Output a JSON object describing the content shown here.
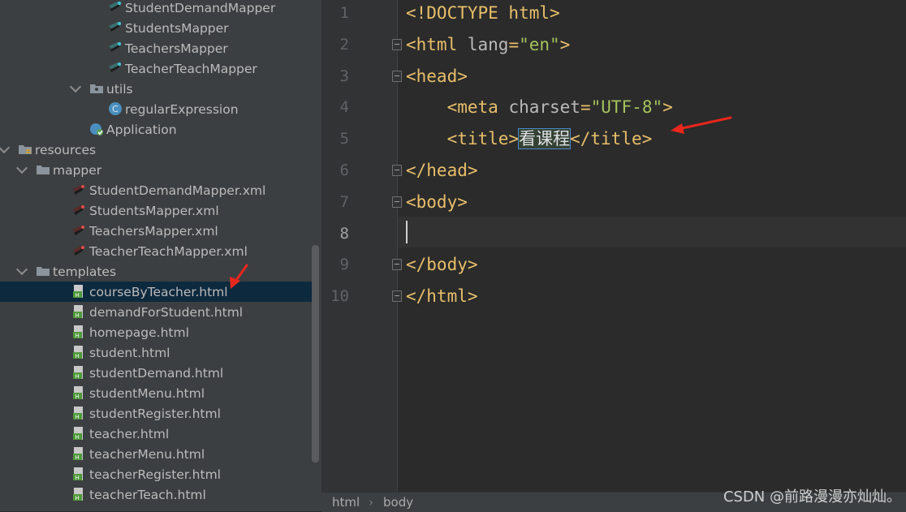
{
  "project_tree": [
    {
      "label": "StudentDemandMapper",
      "icon": "mapper-interface-icon",
      "level": 6,
      "expander": "none"
    },
    {
      "label": "StudentsMapper",
      "icon": "mapper-interface-icon",
      "level": 6,
      "expander": "none"
    },
    {
      "label": "TeachersMapper",
      "icon": "mapper-interface-icon",
      "level": 6,
      "expander": "none"
    },
    {
      "label": "TeacherTeachMapper",
      "icon": "mapper-interface-icon",
      "level": 6,
      "expander": "none"
    },
    {
      "label": "utils",
      "icon": "package-folder-icon",
      "level": 5,
      "expander": "open"
    },
    {
      "label": "regularExpression",
      "icon": "java-class-icon",
      "level": 6,
      "expander": "none"
    },
    {
      "label": "Application",
      "icon": "spring-boot-app-icon",
      "level": 5,
      "expander": "none"
    },
    {
      "label": "resources",
      "icon": "resources-folder-icon",
      "level": 1,
      "expander": "open"
    },
    {
      "label": "mapper",
      "icon": "folder-icon",
      "level": 2,
      "expander": "open"
    },
    {
      "label": "StudentDemandMapper.xml",
      "icon": "mybatis-xml-icon",
      "level": 4,
      "expander": "none"
    },
    {
      "label": "StudentsMapper.xml",
      "icon": "mybatis-xml-icon",
      "level": 4,
      "expander": "none"
    },
    {
      "label": "TeachersMapper.xml",
      "icon": "mybatis-xml-icon",
      "level": 4,
      "expander": "none"
    },
    {
      "label": "TeacherTeachMapper.xml",
      "icon": "mybatis-xml-icon",
      "level": 4,
      "expander": "none"
    },
    {
      "label": "templates",
      "icon": "folder-icon",
      "level": 2,
      "expander": "open"
    },
    {
      "label": "courseByTeacher.html",
      "icon": "html-file-icon",
      "level": 4,
      "expander": "none",
      "selected": true
    },
    {
      "label": "demandForStudent.html",
      "icon": "html-file-icon",
      "level": 4,
      "expander": "none"
    },
    {
      "label": "homepage.html",
      "icon": "html-file-icon",
      "level": 4,
      "expander": "none"
    },
    {
      "label": "student.html",
      "icon": "html-file-icon",
      "level": 4,
      "expander": "none"
    },
    {
      "label": "studentDemand.html",
      "icon": "html-file-icon",
      "level": 4,
      "expander": "none"
    },
    {
      "label": "studentMenu.html",
      "icon": "html-file-icon",
      "level": 4,
      "expander": "none"
    },
    {
      "label": "studentRegister.html",
      "icon": "html-file-icon",
      "level": 4,
      "expander": "none"
    },
    {
      "label": "teacher.html",
      "icon": "html-file-icon",
      "level": 4,
      "expander": "none"
    },
    {
      "label": "teacherMenu.html",
      "icon": "html-file-icon",
      "level": 4,
      "expander": "none"
    },
    {
      "label": "teacherRegister.html",
      "icon": "html-file-icon",
      "level": 4,
      "expander": "none"
    },
    {
      "label": "teacherTeach.html",
      "icon": "html-file-icon",
      "level": 4,
      "expander": "none"
    }
  ],
  "editor": {
    "current_line": 8,
    "lines": [
      {
        "n": "1",
        "parts": [
          {
            "t": "<!DOCTYPE html>",
            "c": "tag"
          }
        ]
      },
      {
        "n": "2",
        "parts": [
          {
            "t": "<html ",
            "c": "tag"
          },
          {
            "t": "lang",
            "c": "attr"
          },
          {
            "t": "=",
            "c": "tag"
          },
          {
            "t": "\"en\"",
            "c": "val"
          },
          {
            "t": ">",
            "c": "tag"
          }
        ]
      },
      {
        "n": "3",
        "parts": [
          {
            "t": "<head>",
            "c": "tag"
          }
        ]
      },
      {
        "n": "4",
        "parts": [
          {
            "t": "    ",
            "c": "tag"
          },
          {
            "t": "<meta ",
            "c": "tag"
          },
          {
            "t": "charset",
            "c": "attr"
          },
          {
            "t": "=",
            "c": "tag"
          },
          {
            "t": "\"UTF-8\"",
            "c": "val"
          },
          {
            "t": ">",
            "c": "tag"
          }
        ]
      },
      {
        "n": "5",
        "parts": [
          {
            "t": "    ",
            "c": "tag"
          },
          {
            "t": "<title>",
            "c": "tag"
          },
          {
            "t": "看课程",
            "c": "txt"
          },
          {
            "t": "</title>",
            "c": "tag"
          }
        ]
      },
      {
        "n": "6",
        "parts": [
          {
            "t": "</head>",
            "c": "tag"
          }
        ]
      },
      {
        "n": "7",
        "parts": [
          {
            "t": "<body>",
            "c": "tag"
          }
        ]
      },
      {
        "n": "8",
        "parts": []
      },
      {
        "n": "9",
        "parts": [
          {
            "t": "</body>",
            "c": "tag"
          }
        ]
      },
      {
        "n": "10",
        "parts": [
          {
            "t": "</html>",
            "c": "tag"
          }
        ]
      }
    ]
  },
  "breadcrumbs": [
    "html",
    "body"
  ],
  "watermark": "CSDN @前路漫漫亦灿灿。",
  "colors": {
    "tag": "#e8bf6a",
    "attr": "#bababa",
    "value": "#a5c25c",
    "selection": "#0d293e",
    "annotation_arrow": "#e8261d"
  }
}
